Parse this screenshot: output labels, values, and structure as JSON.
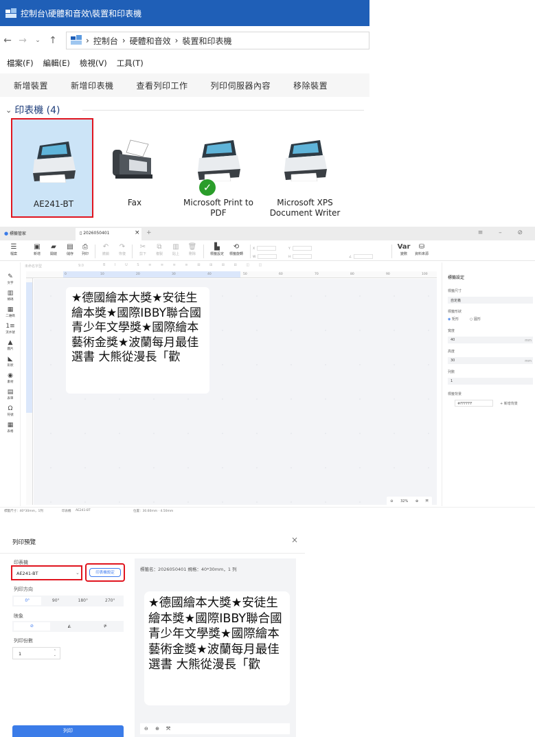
{
  "explorer": {
    "title": "控制台\\硬體和音效\\裝置和印表機",
    "breadcrumb": [
      "控制台",
      "硬體和音效",
      "裝置和印表機"
    ],
    "menu": [
      "檔案(F)",
      "編輯(E)",
      "檢視(V)",
      "工具(T)"
    ],
    "commands": [
      "新增裝置",
      "新增印表機",
      "查看列印工作",
      "列印伺服器內容",
      "移除裝置"
    ],
    "group_label": "印表機 (4)",
    "devices": [
      {
        "label": "AE241-BT",
        "selected": true
      },
      {
        "label": "Fax"
      },
      {
        "label": "Microsoft Print to PDF",
        "default": true
      },
      {
        "label": "Microsoft XPS Document Writer"
      }
    ]
  },
  "editor": {
    "tab_home": "標籤管家",
    "tab_doc": "2026050401",
    "toolbar": [
      "檔案",
      "新增",
      "開啟",
      "儲存",
      "列印",
      "撤銷",
      "恢復",
      "剪下",
      "複製",
      "貼上",
      "刪除",
      "標籤設定",
      "標籤旋轉",
      "變數",
      "資料來源"
    ],
    "format_font": "未命名字型",
    "format_size": "9.0",
    "left_tools": [
      "文字",
      "條碼",
      "二維碼",
      "流水號",
      "圖片",
      "形狀",
      "素材",
      "表單",
      "符號",
      "表格"
    ],
    "ruler_ticks": [
      "0",
      "10",
      "20",
      "30",
      "40",
      "50",
      "60",
      "70",
      "80",
      "90",
      "100"
    ],
    "label_text": "★德國繪本大獎★安徒生繪本獎★國際IBBY聯合國青少年文學獎★國際繪本藝術金獎★波蘭每月最佳選書 大熊從漫長「歡",
    "zoom": "32%",
    "panel": {
      "title": "標籤設定",
      "size_label": "標籤尺寸",
      "size_value": "自定義",
      "shape_label": "標籤形狀",
      "shape_rect": "矩形",
      "shape_round": "圓形",
      "width_label": "寬度",
      "width_value": "40",
      "height_label": "高度",
      "height_value": "30",
      "cols_label": "列數",
      "cols_value": "1",
      "unit": "mm",
      "bg_label": "標籤背景",
      "bg_color": "#FFFFFF",
      "bg_add": "+ 新增背景"
    },
    "status": {
      "size": "標籤尺寸：40*30mm，1列",
      "printer_label": "印表機",
      "printer": "AE241-BT",
      "position": "位置：30.60mm · 4.50mm"
    }
  },
  "preview": {
    "title": "列印預覽",
    "printer_label": "印表機",
    "printer": "AE241-BT",
    "printer_settings": "印表機設定",
    "direction_label": "列印方向",
    "directions": [
      "0°",
      "90°",
      "180°",
      "270°"
    ],
    "mirror_label": "映象",
    "mirrors": [
      "⊘",
      "◭",
      "⋫"
    ],
    "copies_label": "列印份數",
    "copies": "1",
    "print_button": "列印",
    "meta": "標籤名：2026050401  規格：40*30mm，1 列",
    "label_text": "★德國繪本大獎★安徒生繪本獎★國際IBBY聯合國青少年文學獎★國際繪本藝術金獎★波蘭每月最佳選書 大熊從漫長「歡"
  },
  "colors": {
    "titlebar": "#1f5fb7",
    "highlight": "#e0141e",
    "accent": "#3b7ce8"
  }
}
